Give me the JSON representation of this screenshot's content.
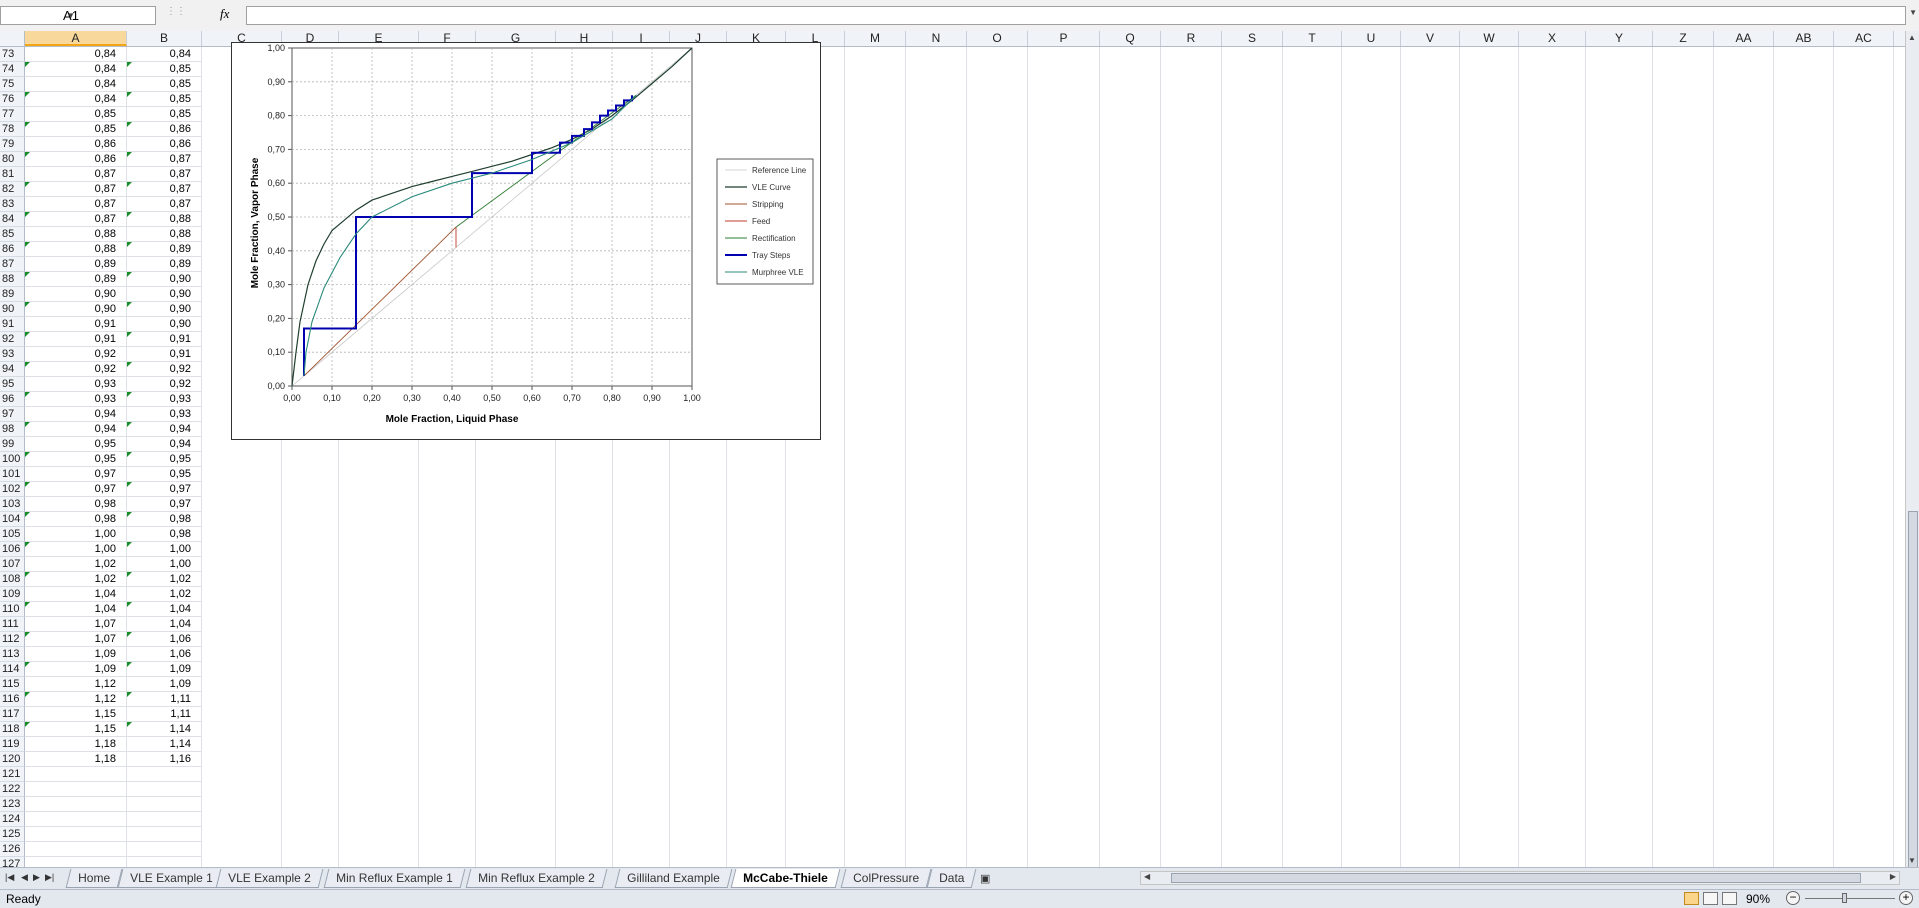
{
  "namebox": {
    "value": "A1"
  },
  "formula": {
    "fx_label": "fx",
    "value": ""
  },
  "columns": [
    "A",
    "B",
    "C",
    "D",
    "E",
    "F",
    "G",
    "H",
    "I",
    "J",
    "K",
    "L",
    "M",
    "N",
    "O",
    "P",
    "Q",
    "R",
    "S",
    "T",
    "U",
    "V",
    "W",
    "X",
    "Y",
    "Z",
    "AA",
    "AB",
    "AC"
  ],
  "selected_column": "A",
  "rows": [
    {
      "n": "73",
      "a": "0,84",
      "b": "0,84",
      "ta": false,
      "tb": false
    },
    {
      "n": "74",
      "a": "0,84",
      "b": "0,85",
      "ta": true,
      "tb": true
    },
    {
      "n": "75",
      "a": "0,84",
      "b": "0,85",
      "ta": false,
      "tb": false
    },
    {
      "n": "76",
      "a": "0,84",
      "b": "0,85",
      "ta": true,
      "tb": true
    },
    {
      "n": "77",
      "a": "0,85",
      "b": "0,85",
      "ta": false,
      "tb": false
    },
    {
      "n": "78",
      "a": "0,85",
      "b": "0,86",
      "ta": true,
      "tb": true
    },
    {
      "n": "79",
      "a": "0,86",
      "b": "0,86",
      "ta": false,
      "tb": false
    },
    {
      "n": "80",
      "a": "0,86",
      "b": "0,87",
      "ta": true,
      "tb": true
    },
    {
      "n": "81",
      "a": "0,87",
      "b": "0,87",
      "ta": false,
      "tb": false
    },
    {
      "n": "82",
      "a": "0,87",
      "b": "0,87",
      "ta": true,
      "tb": true
    },
    {
      "n": "83",
      "a": "0,87",
      "b": "0,87",
      "ta": false,
      "tb": false
    },
    {
      "n": "84",
      "a": "0,87",
      "b": "0,88",
      "ta": true,
      "tb": true
    },
    {
      "n": "85",
      "a": "0,88",
      "b": "0,88",
      "ta": false,
      "tb": false
    },
    {
      "n": "86",
      "a": "0,88",
      "b": "0,89",
      "ta": true,
      "tb": true
    },
    {
      "n": "87",
      "a": "0,89",
      "b": "0,89",
      "ta": false,
      "tb": false
    },
    {
      "n": "88",
      "a": "0,89",
      "b": "0,90",
      "ta": true,
      "tb": true
    },
    {
      "n": "89",
      "a": "0,90",
      "b": "0,90",
      "ta": false,
      "tb": false
    },
    {
      "n": "90",
      "a": "0,90",
      "b": "0,90",
      "ta": true,
      "tb": true
    },
    {
      "n": "91",
      "a": "0,91",
      "b": "0,90",
      "ta": false,
      "tb": false
    },
    {
      "n": "92",
      "a": "0,91",
      "b": "0,91",
      "ta": true,
      "tb": true
    },
    {
      "n": "93",
      "a": "0,92",
      "b": "0,91",
      "ta": false,
      "tb": false
    },
    {
      "n": "94",
      "a": "0,92",
      "b": "0,92",
      "ta": true,
      "tb": true
    },
    {
      "n": "95",
      "a": "0,93",
      "b": "0,92",
      "ta": false,
      "tb": false
    },
    {
      "n": "96",
      "a": "0,93",
      "b": "0,93",
      "ta": true,
      "tb": true
    },
    {
      "n": "97",
      "a": "0,94",
      "b": "0,93",
      "ta": false,
      "tb": false
    },
    {
      "n": "98",
      "a": "0,94",
      "b": "0,94",
      "ta": true,
      "tb": true
    },
    {
      "n": "99",
      "a": "0,95",
      "b": "0,94",
      "ta": false,
      "tb": false
    },
    {
      "n": "100",
      "a": "0,95",
      "b": "0,95",
      "ta": true,
      "tb": true
    },
    {
      "n": "101",
      "a": "0,97",
      "b": "0,95",
      "ta": false,
      "tb": false
    },
    {
      "n": "102",
      "a": "0,97",
      "b": "0,97",
      "ta": true,
      "tb": true
    },
    {
      "n": "103",
      "a": "0,98",
      "b": "0,97",
      "ta": false,
      "tb": false
    },
    {
      "n": "104",
      "a": "0,98",
      "b": "0,98",
      "ta": true,
      "tb": true
    },
    {
      "n": "105",
      "a": "1,00",
      "b": "0,98",
      "ta": false,
      "tb": false
    },
    {
      "n": "106",
      "a": "1,00",
      "b": "1,00",
      "ta": true,
      "tb": true
    },
    {
      "n": "107",
      "a": "1,02",
      "b": "1,00",
      "ta": false,
      "tb": false
    },
    {
      "n": "108",
      "a": "1,02",
      "b": "1,02",
      "ta": true,
      "tb": true
    },
    {
      "n": "109",
      "a": "1,04",
      "b": "1,02",
      "ta": false,
      "tb": false
    },
    {
      "n": "110",
      "a": "1,04",
      "b": "1,04",
      "ta": true,
      "tb": true
    },
    {
      "n": "111",
      "a": "1,07",
      "b": "1,04",
      "ta": false,
      "tb": false
    },
    {
      "n": "112",
      "a": "1,07",
      "b": "1,06",
      "ta": true,
      "tb": true
    },
    {
      "n": "113",
      "a": "1,09",
      "b": "1,06",
      "ta": false,
      "tb": false
    },
    {
      "n": "114",
      "a": "1,09",
      "b": "1,09",
      "ta": true,
      "tb": true
    },
    {
      "n": "115",
      "a": "1,12",
      "b": "1,09",
      "ta": false,
      "tb": false
    },
    {
      "n": "116",
      "a": "1,12",
      "b": "1,11",
      "ta": true,
      "tb": true
    },
    {
      "n": "117",
      "a": "1,15",
      "b": "1,11",
      "ta": false,
      "tb": false
    },
    {
      "n": "118",
      "a": "1,15",
      "b": "1,14",
      "ta": true,
      "tb": true
    },
    {
      "n": "119",
      "a": "1,18",
      "b": "1,14",
      "ta": false,
      "tb": false
    },
    {
      "n": "120",
      "a": "1,18",
      "b": "1,16",
      "ta": false,
      "tb": false
    },
    {
      "n": "121",
      "a": "",
      "b": "",
      "ta": false,
      "tb": false
    },
    {
      "n": "122",
      "a": "",
      "b": "",
      "ta": false,
      "tb": false
    },
    {
      "n": "123",
      "a": "",
      "b": "",
      "ta": false,
      "tb": false
    },
    {
      "n": "124",
      "a": "",
      "b": "",
      "ta": false,
      "tb": false
    },
    {
      "n": "125",
      "a": "",
      "b": "",
      "ta": false,
      "tb": false
    },
    {
      "n": "126",
      "a": "",
      "b": "",
      "ta": false,
      "tb": false
    },
    {
      "n": "127",
      "a": "",
      "b": "",
      "ta": false,
      "tb": false
    }
  ],
  "chart_data": {
    "type": "line",
    "xlabel": "Mole Fraction, Liquid Phase",
    "ylabel": "Mole Fraction, Vapor Phase",
    "xlim": [
      0,
      1
    ],
    "ylim": [
      0,
      1
    ],
    "xticks": [
      "0,00",
      "0,10",
      "0,20",
      "0,30",
      "0,40",
      "0,50",
      "0,60",
      "0,70",
      "0,80",
      "0,90",
      "1,00"
    ],
    "yticks": [
      "0,00",
      "0,10",
      "0,20",
      "0,30",
      "0,40",
      "0,50",
      "0,60",
      "0,70",
      "0,80",
      "0,90",
      "1,00"
    ],
    "grid": true,
    "legend_position": "right",
    "series": [
      {
        "name": "Reference Line",
        "color": "#c8c8c8",
        "width": 0.8,
        "points": [
          [
            0,
            0
          ],
          [
            1,
            1
          ]
        ]
      },
      {
        "name": "VLE Curve",
        "color": "#1f3f2f",
        "width": 1.2,
        "points": [
          [
            0,
            0
          ],
          [
            0.01,
            0.1
          ],
          [
            0.02,
            0.19
          ],
          [
            0.04,
            0.3
          ],
          [
            0.06,
            0.37
          ],
          [
            0.08,
            0.42
          ],
          [
            0.1,
            0.46
          ],
          [
            0.13,
            0.49
          ],
          [
            0.16,
            0.52
          ],
          [
            0.2,
            0.55
          ],
          [
            0.25,
            0.57
          ],
          [
            0.3,
            0.59
          ],
          [
            0.35,
            0.605
          ],
          [
            0.4,
            0.62
          ],
          [
            0.45,
            0.635
          ],
          [
            0.5,
            0.65
          ],
          [
            0.55,
            0.665
          ],
          [
            0.6,
            0.685
          ],
          [
            0.65,
            0.705
          ],
          [
            0.7,
            0.73
          ],
          [
            0.75,
            0.76
          ],
          [
            0.8,
            0.8
          ],
          [
            0.85,
            0.845
          ],
          [
            0.9,
            0.895
          ],
          [
            0.95,
            0.945
          ],
          [
            1,
            1
          ]
        ]
      },
      {
        "name": "Stripping",
        "color": "#a0522d",
        "width": 0.9,
        "points": [
          [
            0.03,
            0.03
          ],
          [
            0.41,
            0.47
          ]
        ]
      },
      {
        "name": "Feed",
        "color": "#c0392b",
        "width": 0.9,
        "points": [
          [
            0.41,
            0.41
          ],
          [
            0.41,
            0.47
          ]
        ]
      },
      {
        "name": "Rectification",
        "color": "#2e7d32",
        "width": 0.9,
        "points": [
          [
            0.41,
            0.47
          ],
          [
            0.86,
            0.86
          ]
        ]
      },
      {
        "name": "Tray Steps",
        "color": "#0000b0",
        "width": 2,
        "points": [
          [
            0.03,
            0.03
          ],
          [
            0.03,
            0.17
          ],
          [
            0.16,
            0.17
          ],
          [
            0.16,
            0.5
          ],
          [
            0.45,
            0.5
          ],
          [
            0.45,
            0.63
          ],
          [
            0.6,
            0.63
          ],
          [
            0.6,
            0.69
          ],
          [
            0.67,
            0.69
          ],
          [
            0.67,
            0.72
          ],
          [
            0.7,
            0.72
          ],
          [
            0.7,
            0.74
          ],
          [
            0.73,
            0.74
          ],
          [
            0.73,
            0.76
          ],
          [
            0.75,
            0.76
          ],
          [
            0.75,
            0.78
          ],
          [
            0.77,
            0.78
          ],
          [
            0.77,
            0.8
          ],
          [
            0.79,
            0.8
          ],
          [
            0.79,
            0.815
          ],
          [
            0.81,
            0.815
          ],
          [
            0.81,
            0.83
          ],
          [
            0.83,
            0.83
          ],
          [
            0.83,
            0.845
          ],
          [
            0.85,
            0.845
          ],
          [
            0.85,
            0.86
          ]
        ]
      },
      {
        "name": "Murphree VLE",
        "color": "#2a8a7a",
        "width": 1.1,
        "points": [
          [
            0.03,
            0.03
          ],
          [
            0.035,
            0.1
          ],
          [
            0.05,
            0.19
          ],
          [
            0.08,
            0.29
          ],
          [
            0.12,
            0.38
          ],
          [
            0.16,
            0.45
          ],
          [
            0.2,
            0.5
          ],
          [
            0.3,
            0.56
          ],
          [
            0.4,
            0.6
          ],
          [
            0.5,
            0.63
          ],
          [
            0.6,
            0.67
          ],
          [
            0.7,
            0.72
          ],
          [
            0.8,
            0.79
          ],
          [
            0.86,
            0.86
          ]
        ]
      }
    ]
  },
  "tabs": [
    {
      "label": "Home"
    },
    {
      "label": "VLE Example 1"
    },
    {
      "label": "VLE Example 2"
    },
    {
      "label": "Min Reflux Example 1"
    },
    {
      "label": "Min Reflux Example 2"
    },
    {
      "label": "Gilliland Example"
    },
    {
      "label": "McCabe-Thiele",
      "active": true
    },
    {
      "label": "ColPressure"
    },
    {
      "label": "Data"
    }
  ],
  "status": {
    "text": "Ready",
    "zoom": "90%"
  }
}
